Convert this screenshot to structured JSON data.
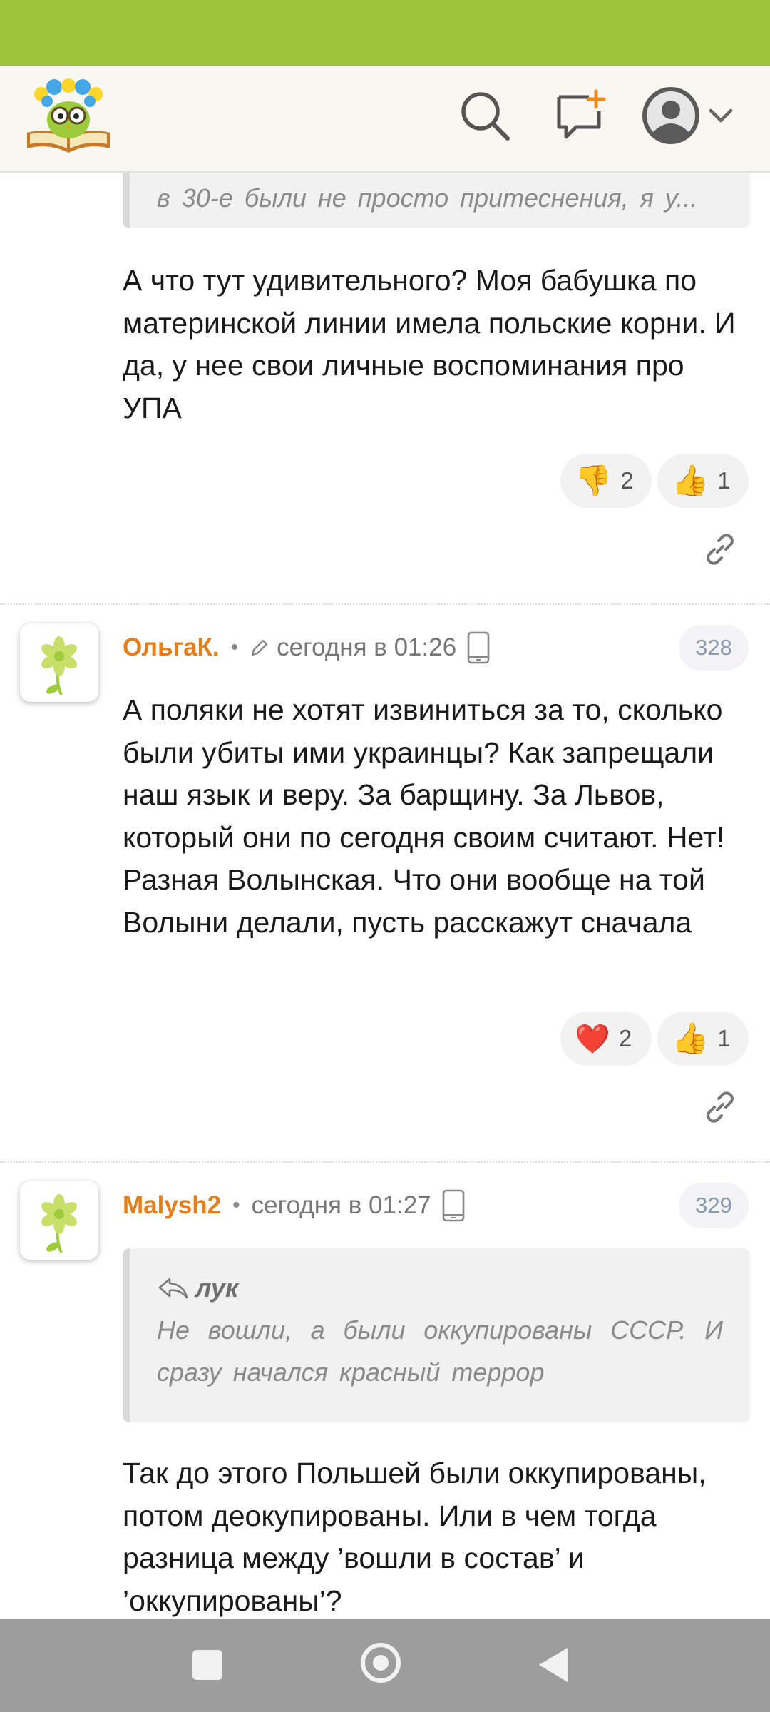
{
  "colors": {
    "status_bar": "#9dc23c",
    "accent_username": "#e67e1a",
    "nav_bar": "#9d9d9d"
  },
  "appbar": {
    "logo_icon": "book-owl-logo-icon",
    "search_icon": "search-icon",
    "new_post_icon": "add-comment-icon",
    "profile_icon": "avatar-icon",
    "menu_icon": "chevron-down-icon"
  },
  "comments": [
    {
      "quote_text": "в 30-е были не просто притеснения, я у...",
      "text": "А что тут удивительного? Моя бабушка по материнской линии имела польские корни. И да, у нее свои личные воспоминания про УПА",
      "reactions": [
        {
          "icon": "thumbs-down-icon",
          "emoji": "👎",
          "count": "2"
        },
        {
          "icon": "thumbs-up-icon",
          "emoji": "👍",
          "count": "1"
        }
      ]
    },
    {
      "author": "ОльгаК.",
      "time": "сегодня в 01:26",
      "number": "328",
      "text": "А поляки не хотят извиниться за то, сколько были убиты ими украинцы? Как запрещали наш язык и веру. За барщину. За Львов, который они по сегодня своим считают. Нет! Разная Волынская. Что они вообще на той Волыни делали, пусть расскажут сначала",
      "reactions": [
        {
          "icon": "heart-icon",
          "emoji": "❤️",
          "count": "2"
        },
        {
          "icon": "thumbs-up-icon",
          "emoji": "👍",
          "count": "1"
        }
      ]
    },
    {
      "author": "Malysh2",
      "time": "сегодня в 01:27",
      "number": "329",
      "quote_author": "лук",
      "quote_text": "Не вошли, а были оккупированы СССР. И сразу начался красный террор",
      "text": "Так до этого Польшей были оккупированы, потом деокупированы. Или в чем тогда разница между ’вошли в состав’ и ’оккупированы’?"
    }
  ],
  "navbar": {
    "recent_icon": "square-recents-icon",
    "home_icon": "circle-home-icon",
    "back_icon": "triangle-back-icon"
  }
}
